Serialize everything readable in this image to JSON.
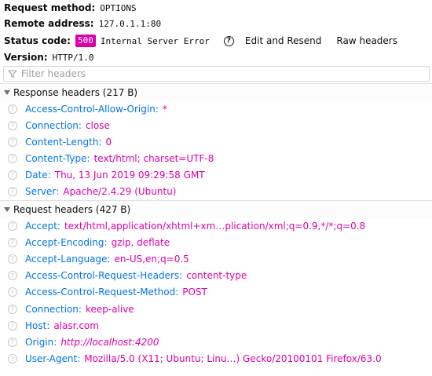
{
  "summary": {
    "request_method": {
      "label": "Request method:",
      "value": "OPTIONS"
    },
    "remote_address": {
      "label": "Remote address:",
      "value": "127.0.1.1:80"
    },
    "status": {
      "label": "Status code:",
      "code": "500",
      "text": "Internal Server Error",
      "badge_color": "#dd00a9"
    },
    "version": {
      "label": "Version:",
      "value": "HTTP/1.0"
    }
  },
  "toolbar": {
    "help_glyph": "?",
    "edit_resend_label": "Edit and Resend",
    "raw_headers_label": "Raw headers"
  },
  "filter": {
    "placeholder": "Filter headers",
    "value": ""
  },
  "response_headers": {
    "title": "Response headers (217 B)",
    "items": [
      {
        "name": "Access-Control-Allow-Origin",
        "value": "*"
      },
      {
        "name": "Connection",
        "value": "close"
      },
      {
        "name": "Content-Length",
        "value": "0"
      },
      {
        "name": "Content-Type",
        "value": "text/html; charset=UTF-8"
      },
      {
        "name": "Date",
        "value": "Thu, 13 Jun 2019 09:29:58 GMT"
      },
      {
        "name": "Server",
        "value": "Apache/2.4.29 (Ubuntu)"
      }
    ]
  },
  "request_headers": {
    "title": "Request headers (427 B)",
    "items": [
      {
        "name": "Accept",
        "value": "text/html,application/xhtml+xm…plication/xml;q=0.9,*/*;q=0.8"
      },
      {
        "name": "Accept-Encoding",
        "value": "gzip, deflate"
      },
      {
        "name": "Accept-Language",
        "value": "en-US,en;q=0.5"
      },
      {
        "name": "Access-Control-Request-Headers",
        "value": "content-type"
      },
      {
        "name": "Access-Control-Request-Method",
        "value": "POST"
      },
      {
        "name": "Connection",
        "value": "keep-alive"
      },
      {
        "name": "Host",
        "value": "alasr.com"
      },
      {
        "name": "Origin",
        "value": "http://localhost:4200"
      },
      {
        "name": "User-Agent",
        "value": "Mozilla/5.0 (X11; Ubuntu; Linu…) Gecko/20100101 Firefox/63.0"
      }
    ]
  },
  "colors": {
    "header_name": "#0074e8",
    "header_value": "#dd00a9"
  },
  "icons": {
    "row_help": "question-circle-icon",
    "filter": "filter-icon",
    "twisty": "triangle-down-icon"
  }
}
